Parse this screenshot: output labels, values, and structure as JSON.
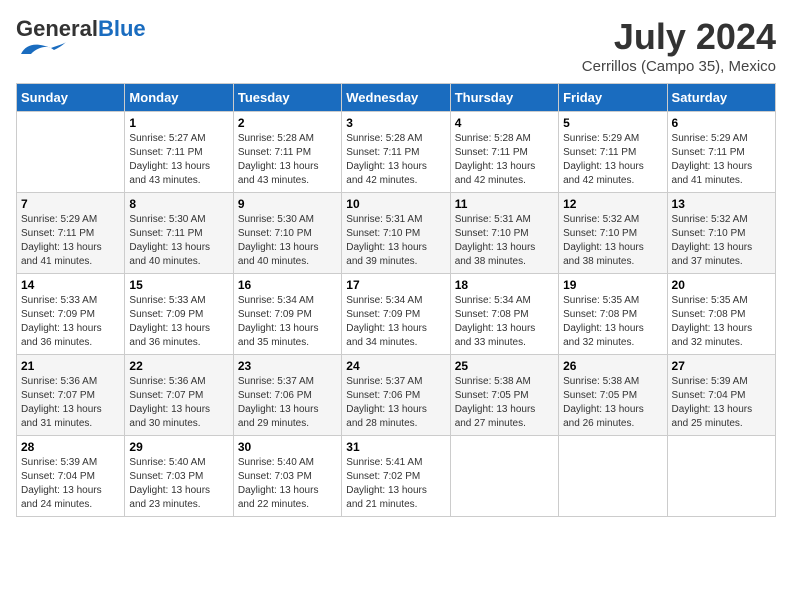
{
  "header": {
    "logo_general": "General",
    "logo_blue": "Blue",
    "month_year": "July 2024",
    "location": "Cerrillos (Campo 35), Mexico"
  },
  "weekdays": [
    "Sunday",
    "Monday",
    "Tuesday",
    "Wednesday",
    "Thursday",
    "Friday",
    "Saturday"
  ],
  "weeks": [
    [
      {
        "day": "",
        "sunrise": "",
        "sunset": "",
        "daylight": ""
      },
      {
        "day": "1",
        "sunrise": "Sunrise: 5:27 AM",
        "sunset": "Sunset: 7:11 PM",
        "daylight": "Daylight: 13 hours and 43 minutes."
      },
      {
        "day": "2",
        "sunrise": "Sunrise: 5:28 AM",
        "sunset": "Sunset: 7:11 PM",
        "daylight": "Daylight: 13 hours and 43 minutes."
      },
      {
        "day": "3",
        "sunrise": "Sunrise: 5:28 AM",
        "sunset": "Sunset: 7:11 PM",
        "daylight": "Daylight: 13 hours and 42 minutes."
      },
      {
        "day": "4",
        "sunrise": "Sunrise: 5:28 AM",
        "sunset": "Sunset: 7:11 PM",
        "daylight": "Daylight: 13 hours and 42 minutes."
      },
      {
        "day": "5",
        "sunrise": "Sunrise: 5:29 AM",
        "sunset": "Sunset: 7:11 PM",
        "daylight": "Daylight: 13 hours and 42 minutes."
      },
      {
        "day": "6",
        "sunrise": "Sunrise: 5:29 AM",
        "sunset": "Sunset: 7:11 PM",
        "daylight": "Daylight: 13 hours and 41 minutes."
      }
    ],
    [
      {
        "day": "7",
        "sunrise": "Sunrise: 5:29 AM",
        "sunset": "Sunset: 7:11 PM",
        "daylight": "Daylight: 13 hours and 41 minutes."
      },
      {
        "day": "8",
        "sunrise": "Sunrise: 5:30 AM",
        "sunset": "Sunset: 7:11 PM",
        "daylight": "Daylight: 13 hours and 40 minutes."
      },
      {
        "day": "9",
        "sunrise": "Sunrise: 5:30 AM",
        "sunset": "Sunset: 7:10 PM",
        "daylight": "Daylight: 13 hours and 40 minutes."
      },
      {
        "day": "10",
        "sunrise": "Sunrise: 5:31 AM",
        "sunset": "Sunset: 7:10 PM",
        "daylight": "Daylight: 13 hours and 39 minutes."
      },
      {
        "day": "11",
        "sunrise": "Sunrise: 5:31 AM",
        "sunset": "Sunset: 7:10 PM",
        "daylight": "Daylight: 13 hours and 38 minutes."
      },
      {
        "day": "12",
        "sunrise": "Sunrise: 5:32 AM",
        "sunset": "Sunset: 7:10 PM",
        "daylight": "Daylight: 13 hours and 38 minutes."
      },
      {
        "day": "13",
        "sunrise": "Sunrise: 5:32 AM",
        "sunset": "Sunset: 7:10 PM",
        "daylight": "Daylight: 13 hours and 37 minutes."
      }
    ],
    [
      {
        "day": "14",
        "sunrise": "Sunrise: 5:33 AM",
        "sunset": "Sunset: 7:09 PM",
        "daylight": "Daylight: 13 hours and 36 minutes."
      },
      {
        "day": "15",
        "sunrise": "Sunrise: 5:33 AM",
        "sunset": "Sunset: 7:09 PM",
        "daylight": "Daylight: 13 hours and 36 minutes."
      },
      {
        "day": "16",
        "sunrise": "Sunrise: 5:34 AM",
        "sunset": "Sunset: 7:09 PM",
        "daylight": "Daylight: 13 hours and 35 minutes."
      },
      {
        "day": "17",
        "sunrise": "Sunrise: 5:34 AM",
        "sunset": "Sunset: 7:09 PM",
        "daylight": "Daylight: 13 hours and 34 minutes."
      },
      {
        "day": "18",
        "sunrise": "Sunrise: 5:34 AM",
        "sunset": "Sunset: 7:08 PM",
        "daylight": "Daylight: 13 hours and 33 minutes."
      },
      {
        "day": "19",
        "sunrise": "Sunrise: 5:35 AM",
        "sunset": "Sunset: 7:08 PM",
        "daylight": "Daylight: 13 hours and 32 minutes."
      },
      {
        "day": "20",
        "sunrise": "Sunrise: 5:35 AM",
        "sunset": "Sunset: 7:08 PM",
        "daylight": "Daylight: 13 hours and 32 minutes."
      }
    ],
    [
      {
        "day": "21",
        "sunrise": "Sunrise: 5:36 AM",
        "sunset": "Sunset: 7:07 PM",
        "daylight": "Daylight: 13 hours and 31 minutes."
      },
      {
        "day": "22",
        "sunrise": "Sunrise: 5:36 AM",
        "sunset": "Sunset: 7:07 PM",
        "daylight": "Daylight: 13 hours and 30 minutes."
      },
      {
        "day": "23",
        "sunrise": "Sunrise: 5:37 AM",
        "sunset": "Sunset: 7:06 PM",
        "daylight": "Daylight: 13 hours and 29 minutes."
      },
      {
        "day": "24",
        "sunrise": "Sunrise: 5:37 AM",
        "sunset": "Sunset: 7:06 PM",
        "daylight": "Daylight: 13 hours and 28 minutes."
      },
      {
        "day": "25",
        "sunrise": "Sunrise: 5:38 AM",
        "sunset": "Sunset: 7:05 PM",
        "daylight": "Daylight: 13 hours and 27 minutes."
      },
      {
        "day": "26",
        "sunrise": "Sunrise: 5:38 AM",
        "sunset": "Sunset: 7:05 PM",
        "daylight": "Daylight: 13 hours and 26 minutes."
      },
      {
        "day": "27",
        "sunrise": "Sunrise: 5:39 AM",
        "sunset": "Sunset: 7:04 PM",
        "daylight": "Daylight: 13 hours and 25 minutes."
      }
    ],
    [
      {
        "day": "28",
        "sunrise": "Sunrise: 5:39 AM",
        "sunset": "Sunset: 7:04 PM",
        "daylight": "Daylight: 13 hours and 24 minutes."
      },
      {
        "day": "29",
        "sunrise": "Sunrise: 5:40 AM",
        "sunset": "Sunset: 7:03 PM",
        "daylight": "Daylight: 13 hours and 23 minutes."
      },
      {
        "day": "30",
        "sunrise": "Sunrise: 5:40 AM",
        "sunset": "Sunset: 7:03 PM",
        "daylight": "Daylight: 13 hours and 22 minutes."
      },
      {
        "day": "31",
        "sunrise": "Sunrise: 5:41 AM",
        "sunset": "Sunset: 7:02 PM",
        "daylight": "Daylight: 13 hours and 21 minutes."
      },
      {
        "day": "",
        "sunrise": "",
        "sunset": "",
        "daylight": ""
      },
      {
        "day": "",
        "sunrise": "",
        "sunset": "",
        "daylight": ""
      },
      {
        "day": "",
        "sunrise": "",
        "sunset": "",
        "daylight": ""
      }
    ]
  ]
}
